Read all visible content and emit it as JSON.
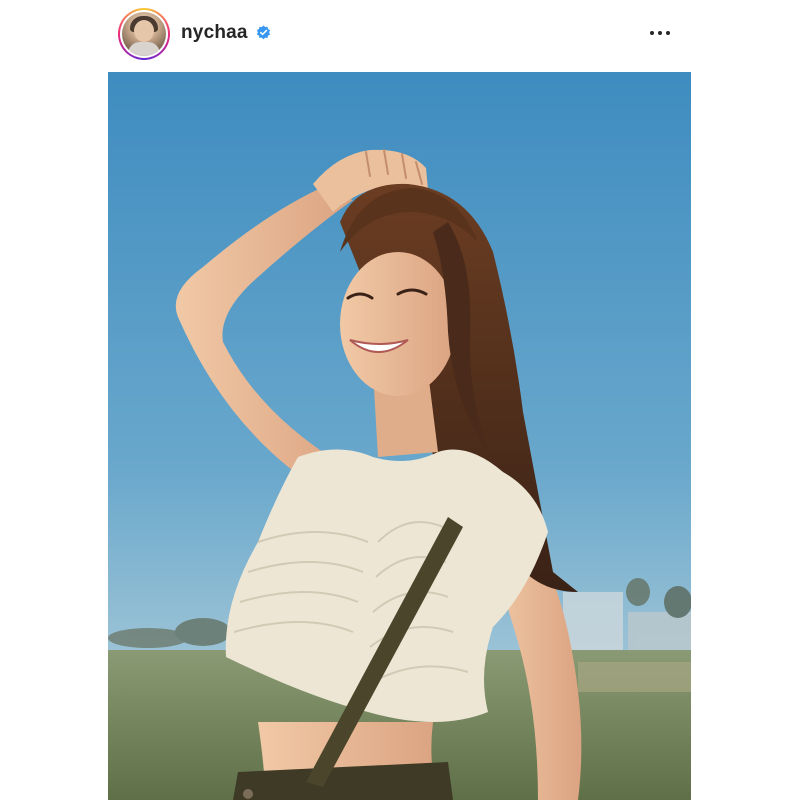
{
  "post": {
    "username": "nychaa",
    "verified": true,
    "avatar_icon": "profile-avatar",
    "verified_icon": "verified-badge-icon",
    "more_icon": "more-options-icon",
    "accent_color": "#3897f0",
    "photo_icon": "post-photo"
  }
}
